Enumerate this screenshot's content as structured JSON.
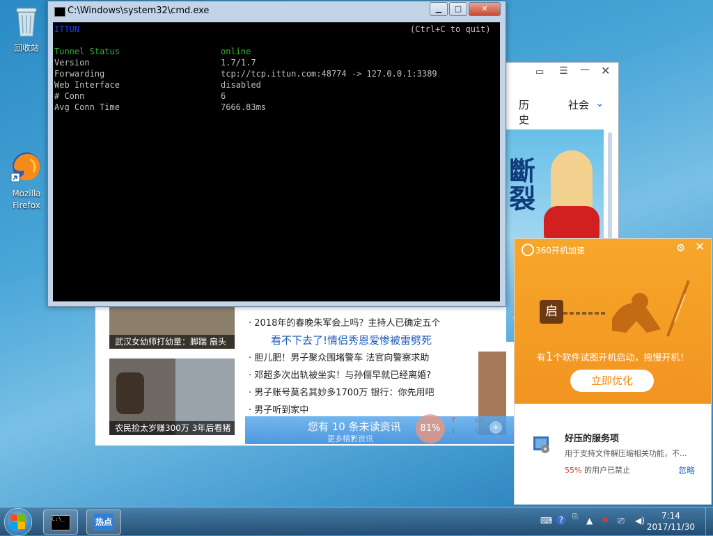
{
  "desktop": {
    "icons": [
      {
        "label": "回收站"
      },
      {
        "label": "Mozilla\nFirefox"
      }
    ]
  },
  "cmd": {
    "title": "C:\\Windows\\system32\\cmd.exe",
    "header_left": "ittun",
    "header_right": "(Ctrl+C to quit)",
    "rows": [
      {
        "key": "Tunnel Status",
        "value": "online"
      },
      {
        "key": "Version",
        "value": "1.7/1.7"
      },
      {
        "key": "Forwarding",
        "value": "tcp://tcp.ittun.com:48774 -> 127.0.0.1:3389"
      },
      {
        "key": "Web Interface",
        "value": "disabled"
      },
      {
        "key": "# Conn",
        "value": "6"
      },
      {
        "key": "Avg Conn Time",
        "value": "7666.83ms"
      }
    ]
  },
  "browser": {
    "nav": [
      "历史",
      "社会"
    ],
    "news": [
      "· 2018年的春晚朱军会上吗？主持人已确定五个",
      "看不下去了!情侣秀恩爱惨被雷劈死",
      "· 胆儿肥！男子聚众围堵警车 法官向警察求助",
      "· 邓超多次出轨被坐实！与孙俪早就已经离婚?",
      "· 男子账号莫名其妙多1700万 银行：你先用吧",
      "· 男子听到家中"
    ],
    "thumb_captions": [
      "武汉女幼师打幼童：脚踹 扇头",
      "农民捡太岁赚300万 3年后看猪"
    ],
    "notify": "您有 10 条未读资讯",
    "notify_sub": "更多精彩资讯",
    "speed_percent": "81%",
    "speed_up": "- K/s",
    "speed_down": "- K/s"
  },
  "popup": {
    "title": "360开机加速",
    "lock_char": "启",
    "msg_pre": "有",
    "msg_num": "1",
    "msg_post": "个软件试图开机启动，拖慢开机！",
    "button": "立即优化",
    "service_title": "好压的服务项",
    "service_desc": "用于支持文件解压缩相关功能，不...",
    "stat_pct": "55%",
    "stat_text": " 的用户已禁止",
    "ignore": "忽略"
  },
  "taskbar": {
    "hot_label": "热点",
    "time": "7:14",
    "date": "2017/11/30"
  },
  "colors": {
    "console_green": "#2fb52f",
    "console_blue": "#1f3cff",
    "popup_orange": "#f29420"
  }
}
